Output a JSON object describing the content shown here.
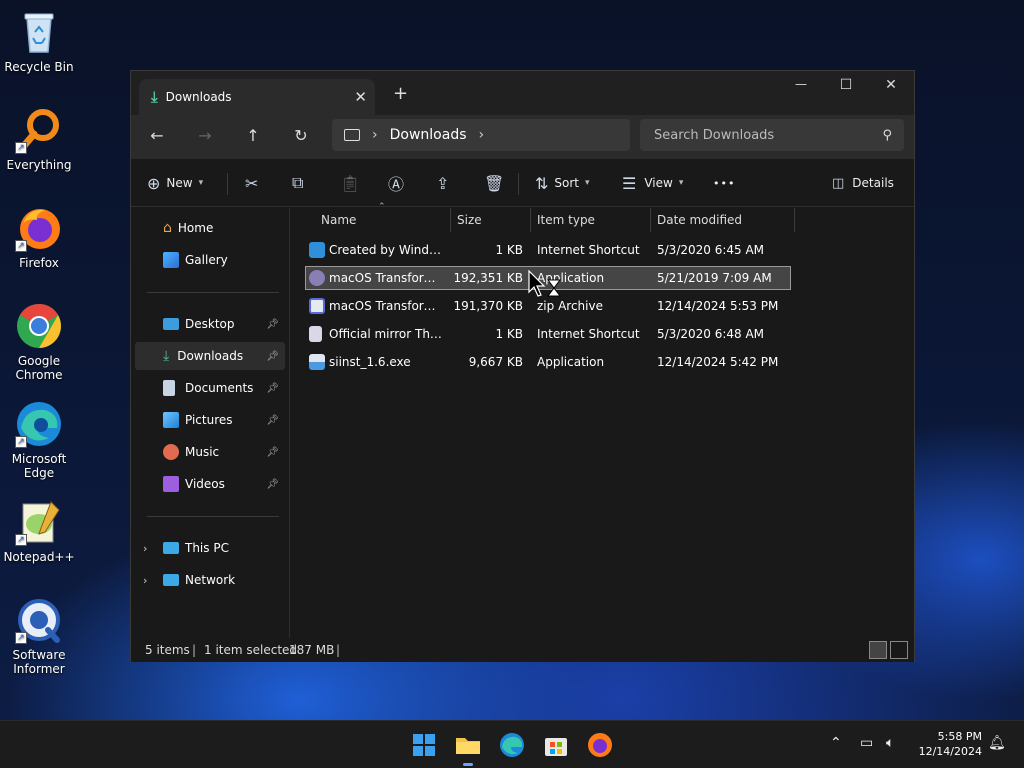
{
  "desktop": {
    "icons": [
      {
        "label": "Recycle Bin"
      },
      {
        "label": "Everything"
      },
      {
        "label": "Firefox"
      },
      {
        "label": "Google Chrome"
      },
      {
        "label": "Microsoft Edge"
      },
      {
        "label": "Notepad++"
      },
      {
        "label": "Software Informer"
      }
    ]
  },
  "window": {
    "tab_title": "Downloads",
    "tab_close": "✕",
    "new_tab": "+",
    "controls": {
      "minimize": "—",
      "maximize": "☐",
      "close": "✕"
    }
  },
  "navbar": {
    "back": "←",
    "forward": "→",
    "up": "↑",
    "refresh": "↻",
    "breadcrumb": "Downloads",
    "search_placeholder": "Search Downloads"
  },
  "toolbar": {
    "new_label": "New",
    "sort_label": "Sort",
    "view_label": "View",
    "more_label": "•••",
    "details_label": "Details"
  },
  "sidebar": {
    "home": "Home",
    "gallery": "Gallery",
    "pinned": [
      "Desktop",
      "Downloads",
      "Documents",
      "Pictures",
      "Music",
      "Videos"
    ],
    "this_pc": "This PC",
    "network": "Network",
    "selected": "Downloads"
  },
  "columns": {
    "name": "Name",
    "size": "Size",
    "type": "Item type",
    "date": "Date modified"
  },
  "files": [
    {
      "name": "Created by Windows...",
      "size": "1 KB",
      "type": "Internet Shortcut",
      "date": "5/3/2020 6:45 AM",
      "icon": "edge-shortcut-icon",
      "color": "#2f8fd8"
    },
    {
      "name": "macOS Transformat...",
      "size": "192,351 KB",
      "type": "Application",
      "date": "5/21/2019 7:09 AM",
      "icon": "app-installer-icon",
      "color": "#8a7fb5",
      "selected": true
    },
    {
      "name": "macOS Transformat...",
      "size": "191,370 KB",
      "type": "zip Archive",
      "date": "12/14/2024 5:53 PM",
      "icon": "zip-archive-icon",
      "color": "#5b6bd6"
    },
    {
      "name": "Official mirror The...",
      "size": "1 KB",
      "type": "Internet Shortcut",
      "date": "5/3/2020 6:48 AM",
      "icon": "web-shortcut-icon",
      "color": "#d8d8e8"
    },
    {
      "name": "siinst_1.6.exe",
      "size": "9,667 KB",
      "type": "Application",
      "date": "12/14/2024 5:42 PM",
      "icon": "installer-icon",
      "color": "#4a9adf"
    }
  ],
  "status": {
    "items": "5 items",
    "selected": "1 item selected",
    "size": "187 MB"
  },
  "taskbar": {
    "time": "5:58 PM",
    "date": "12/14/2024"
  }
}
